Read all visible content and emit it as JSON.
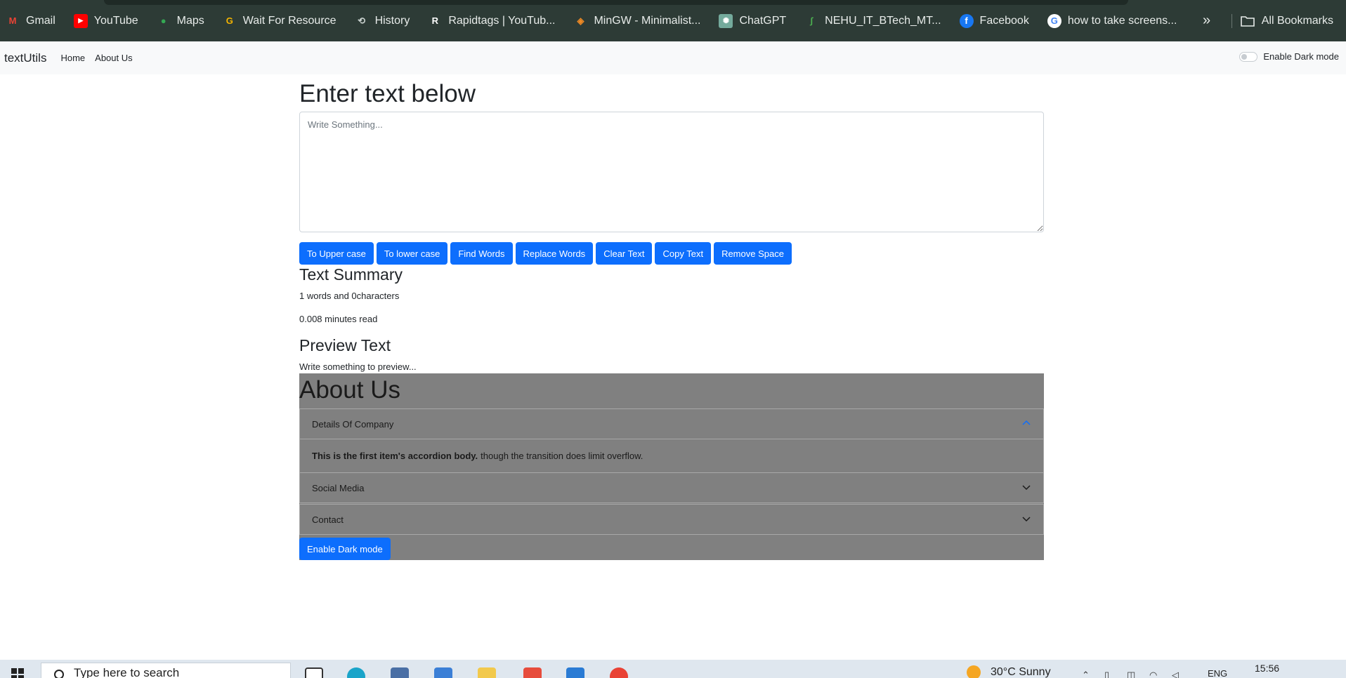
{
  "bookmarks": {
    "items": [
      {
        "label": "Gmail",
        "icon": "gmail-icon",
        "color": "#ea4335"
      },
      {
        "label": "YouTube",
        "icon": "youtube-icon",
        "color": "#ff0000"
      },
      {
        "label": "Maps",
        "icon": "maps-icon",
        "color": "#34a853"
      },
      {
        "label": "Wait For Resource",
        "icon": "g-icon",
        "color": "#f4b400"
      },
      {
        "label": "History",
        "icon": "history-icon",
        "color": "#c9d1ce"
      },
      {
        "label": "Rapidtags | YouTub...",
        "icon": "rapidtags-icon",
        "color": "#111111"
      },
      {
        "label": "MinGW - Minimalist...",
        "icon": "mingw-icon",
        "color": "#f08a24"
      },
      {
        "label": "ChatGPT",
        "icon": "chatgpt-icon",
        "color": "#74aa9c"
      },
      {
        "label": "NEHU_IT_BTech_MT...",
        "icon": "nehu-icon",
        "color": "#4caf50"
      },
      {
        "label": "Facebook",
        "icon": "facebook-icon",
        "color": "#1877f2"
      },
      {
        "label": "how to take screens...",
        "icon": "google-icon",
        "color": "#ffffff"
      }
    ],
    "more": "»",
    "all_bookmarks": "All Bookmarks"
  },
  "navbar": {
    "brand": "textUtils",
    "links": [
      "Home",
      "About Us"
    ],
    "toggle_label": "Enable Dark mode"
  },
  "main": {
    "title": "Enter text below",
    "textarea_placeholder": "Write Something...",
    "textarea_value": "",
    "buttons": [
      "To Upper case",
      "To lower case",
      "Find Words",
      "Replace Words",
      "Clear Text",
      "Copy Text",
      "Remove Space"
    ],
    "summary_title": "Text Summary",
    "summary_words": "1 words and 0characters",
    "summary_read": "0.008 minutes read",
    "preview_title": "Preview Text",
    "preview_text": "Write something to preview..."
  },
  "about": {
    "title": "About Us",
    "accordion": [
      {
        "header": "Details Of Company",
        "expanded": true,
        "body_bold": "This is the first item's accordion body.",
        "body_rest": "though the transition does limit overflow."
      },
      {
        "header": "Social Media",
        "expanded": false
      },
      {
        "header": "Contact",
        "expanded": false
      }
    ],
    "dark_button": "Enable Dark mode"
  },
  "taskbar": {
    "search_placeholder": "Type here to search",
    "weather": "30°C  Sunny",
    "lang": "ENG",
    "time": "15:56"
  },
  "colors": {
    "primary": "#0d6efd",
    "bookmark_bar": "#2d3b36",
    "about_bg": "#808080"
  }
}
